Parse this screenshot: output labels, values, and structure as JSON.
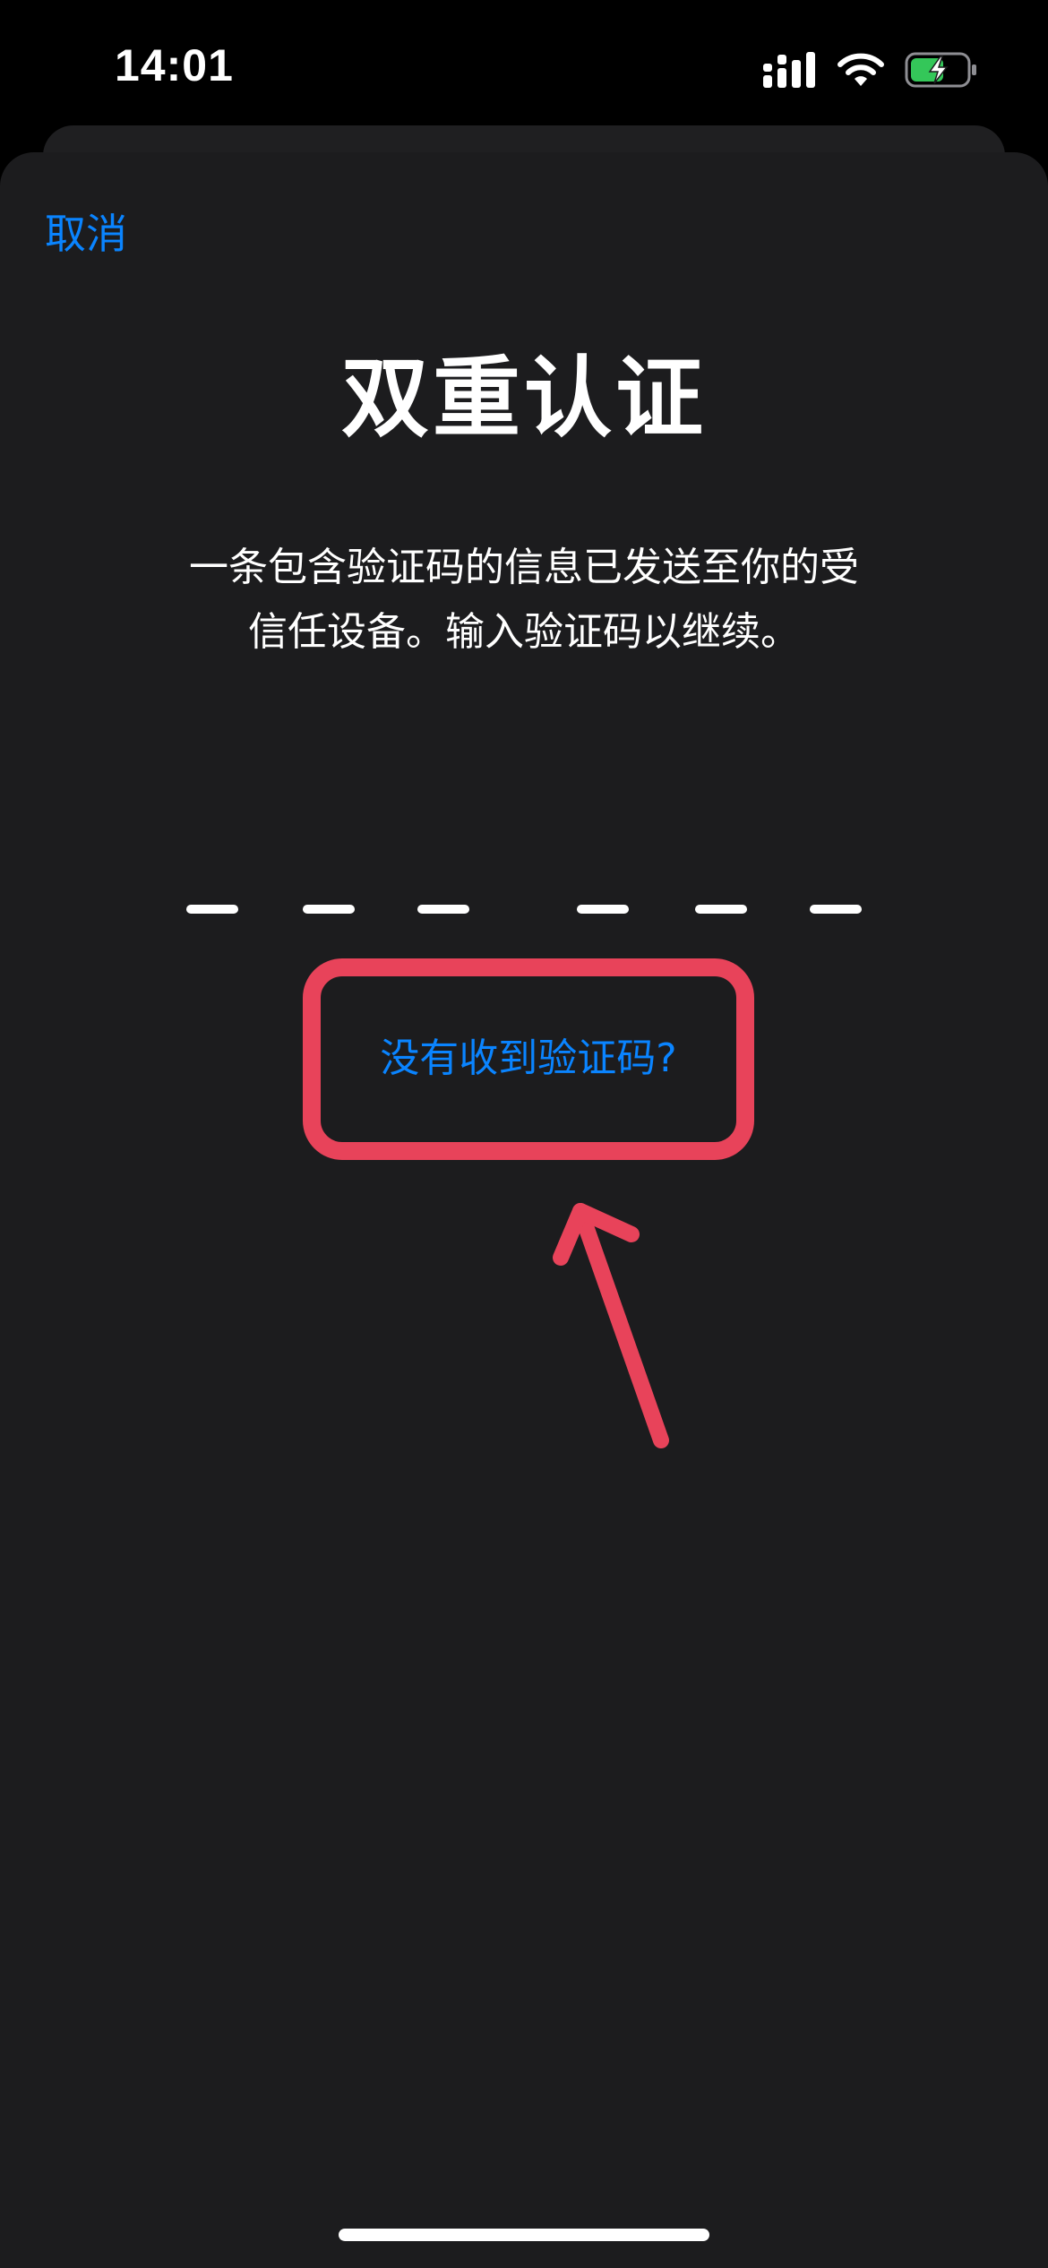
{
  "status_bar": {
    "time": "14:01",
    "icons": [
      "cellular-signal-icon",
      "wifi-icon",
      "battery-charging-icon"
    ],
    "battery_color": "#34c759"
  },
  "nav": {
    "cancel_label": "取消"
  },
  "main": {
    "title": "双重认证",
    "subtitle_line1": "一条包含验证码的信息已发送至你的受",
    "subtitle_line2": "信任设备。输入验证码以继续。",
    "code_slots": 6,
    "resend_label": "没有收到验证码?"
  },
  "colors": {
    "accent": "#0a84ff",
    "background": "#1c1c1e",
    "annotation": "#e8435a"
  }
}
